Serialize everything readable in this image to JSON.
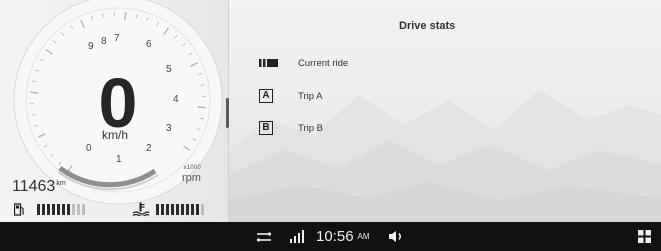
{
  "cluster": {
    "gear": "0",
    "speed_unit": "km/h",
    "rpm_unit": "rpm",
    "rpm_multiplier": "x1000",
    "rpm_ticks": [
      "0",
      "1",
      "2",
      "3",
      "4",
      "5",
      "6",
      "7",
      "8",
      "9"
    ],
    "odometer": {
      "value": "11463",
      "unit": "km"
    },
    "fuel_level": 0.7,
    "temperature_level": 0.9
  },
  "drive_stats": {
    "title": "Drive stats",
    "items": [
      {
        "icon": "current-ride-icon",
        "label": "Current ride"
      },
      {
        "icon": "trip-a-icon",
        "icon_text": "A",
        "label": "Trip A"
      },
      {
        "icon": "trip-b-icon",
        "icon_text": "B",
        "label": "Trip B"
      }
    ]
  },
  "status_bar": {
    "time": "10:56",
    "ampm": "AM"
  },
  "colors": {
    "gauge_arc": "#9a9a9a",
    "status_bar": "#111111"
  }
}
